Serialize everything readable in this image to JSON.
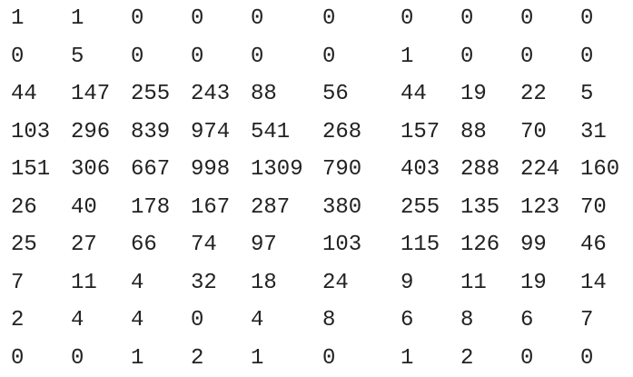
{
  "table": {
    "rows": [
      [
        "1",
        "1",
        "0",
        "0",
        "0",
        "0",
        "0",
        "0",
        "0",
        "0"
      ],
      [
        "0",
        "5",
        "0",
        "0",
        "0",
        "0",
        "1",
        "0",
        "0",
        "0"
      ],
      [
        "44",
        "147",
        "255",
        "243",
        "88",
        "56",
        "44",
        "19",
        "22",
        "5"
      ],
      [
        "103",
        "296",
        "839",
        "974",
        "541",
        "268",
        "157",
        "88",
        "70",
        "31"
      ],
      [
        "151",
        "306",
        "667",
        "998",
        "1309",
        "790",
        "403",
        "288",
        "224",
        "160"
      ],
      [
        "26",
        "40",
        "178",
        "167",
        "287",
        "380",
        "255",
        "135",
        "123",
        "70"
      ],
      [
        "25",
        "27",
        "66",
        "74",
        "97",
        "103",
        "115",
        "126",
        "99",
        "46"
      ],
      [
        "7",
        "11",
        "4",
        "32",
        "18",
        "24",
        "9",
        "11",
        "19",
        "14"
      ],
      [
        "2",
        "4",
        "4",
        "0",
        "4",
        "8",
        "6",
        "8",
        "6",
        "7"
      ],
      [
        "0",
        "0",
        "1",
        "2",
        "1",
        "0",
        "1",
        "2",
        "0",
        "0"
      ]
    ]
  }
}
